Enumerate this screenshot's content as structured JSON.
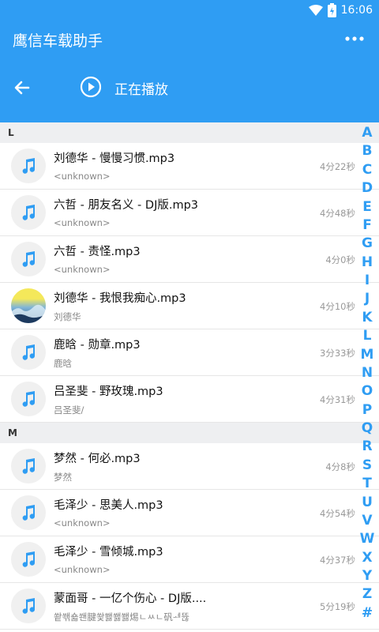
{
  "status": {
    "time": "16:06"
  },
  "app": {
    "title": "鹰信车载助手"
  },
  "player": {
    "now_playing_label": "正在播放"
  },
  "sections": [
    {
      "header": "L",
      "songs": [
        {
          "title": "刘德华 - 慢慢习惯.mp3",
          "artist": "<unknown>",
          "duration": "4分22秒",
          "cover": "music-note-icon"
        },
        {
          "title": "六哲 - 朋友名义 - DJ版.mp3",
          "artist": "<unknown>",
          "duration": "4分48秒",
          "cover": "music-note-icon"
        },
        {
          "title": "六哲 - 责怪.mp3",
          "artist": "<unknown>",
          "duration": "4分0秒",
          "cover": "music-note-icon"
        },
        {
          "title": "刘德华 - 我恨我痴心.mp3",
          "artist": "刘德华",
          "duration": "4分10秒",
          "cover": "album-art-photo"
        },
        {
          "title": "鹿晗 - 勋章.mp3",
          "artist": "鹿晗",
          "duration": "3分33秒",
          "cover": "music-note-icon"
        },
        {
          "title": "吕圣斐 - 野玫瑰.mp3",
          "artist": "吕圣斐/",
          "duration": "4分31秒",
          "cover": "music-note-icon"
        }
      ]
    },
    {
      "header": "M",
      "songs": [
        {
          "title": "梦然 - 何必.mp3",
          "artist": "梦然",
          "duration": "4分8秒",
          "cover": "music-note-icon"
        },
        {
          "title": "毛泽少 - 思美人.mp3",
          "artist": "<unknown>",
          "duration": "4分54秒",
          "cover": "music-note-icon"
        },
        {
          "title": "毛泽少 - 雪倾城.mp3",
          "artist": "<unknown>",
          "duration": "4分37秒",
          "cover": "music-note-icon"
        },
        {
          "title": "蒙面哥 - 一亿个伤心 - DJ版....",
          "artist": "쐍쐒숇쐔腱쐋쐟쐟쐟焬ㄴㅆㄴ矾ᆀ뜒",
          "duration": "5分19秒",
          "cover": "music-note-icon"
        }
      ]
    }
  ],
  "index_letters": [
    "A",
    "B",
    "C",
    "D",
    "E",
    "F",
    "G",
    "H",
    "I",
    "J",
    "K",
    "L",
    "M",
    "N",
    "O",
    "P",
    "Q",
    "R",
    "S",
    "T",
    "U",
    "V",
    "W",
    "X",
    "Y",
    "Z",
    "#"
  ],
  "colors": {
    "accent": "#2f9df3",
    "note": "#2f9df3",
    "section_bg": "#eeeff1"
  }
}
